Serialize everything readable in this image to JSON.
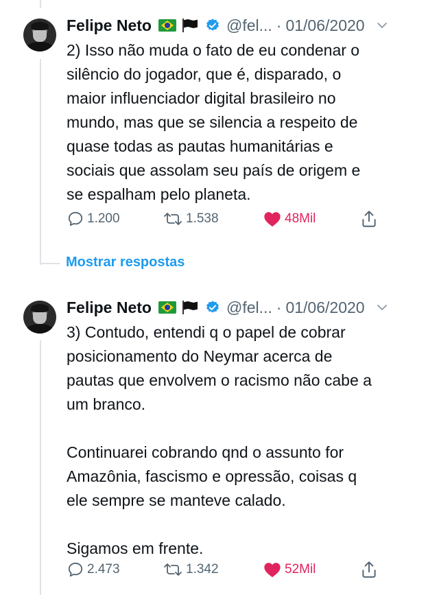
{
  "tweets": [
    {
      "author": "Felipe Neto",
      "handle": "@fel...",
      "separator": "·",
      "date": "01/06/2020",
      "text": "2) Isso não muda o fato de eu condenar o\nsilêncio do jogador, que é, disparado, o\nmaior influenciador digital brasileiro no\nmundo, mas que se silencia a respeito de\nquase todas as pautas humanitárias e\nsociais que assolam seu país de origem e\nse espalham pelo planeta.",
      "replies": "1.200",
      "retweets": "1.538",
      "likes": "48Mil"
    },
    {
      "author": "Felipe Neto",
      "handle": "@fel...",
      "separator": "·",
      "date": "01/06/2020",
      "text": "3) Contudo, entendi q o papel de cobrar\nposicionamento do Neymar acerca de\npautas que envolvem o racismo não cabe a\num branco.\n\nContinuarei cobrando qnd o assunto for\nAmazônia, fascismo e opressão, coisas q\nele sempre se manteve calado.\n\nSigamos em frente.",
      "replies": "2.473",
      "retweets": "1.342",
      "likes": "52Mil"
    }
  ],
  "thread": {
    "show_replies": "Mostrar respostas"
  },
  "icons": {
    "reply": "reply-icon",
    "retweet": "retweet-icon",
    "like": "heart-icon",
    "share": "share-icon",
    "verified": "verified-badge-icon",
    "more": "chevron-down-icon"
  },
  "colors": {
    "text": "#0f1419",
    "muted": "#536471",
    "link": "#1d9bf0",
    "like": "#e0245e",
    "verified": "#1d9bf0"
  }
}
